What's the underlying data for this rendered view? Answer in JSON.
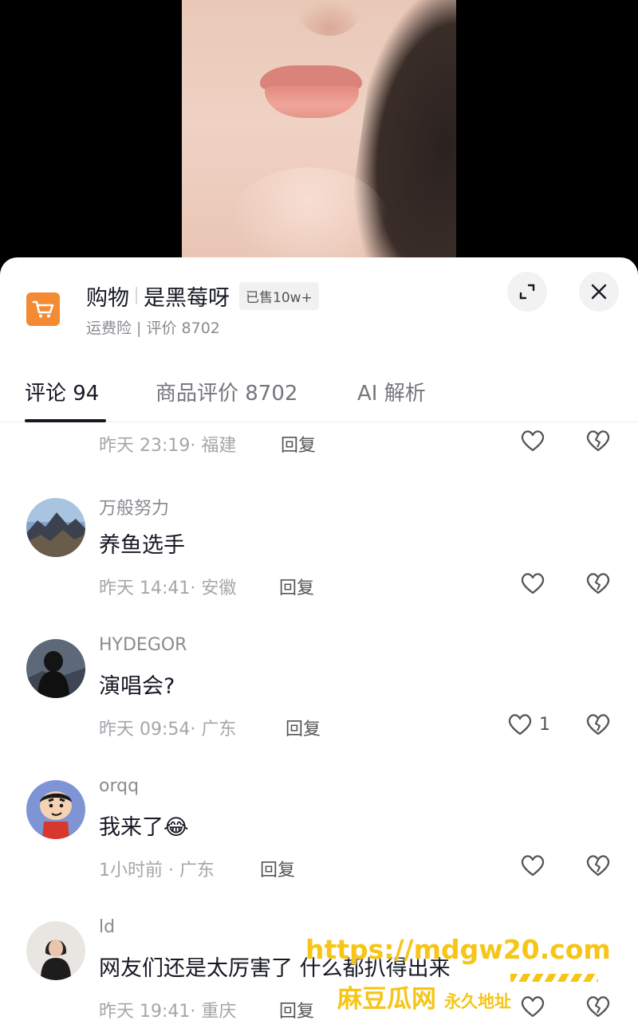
{
  "product": {
    "title": "购物",
    "shop": "是黑莓呀",
    "sold": "已售10w+",
    "meta": "运费险 | 评价 8702"
  },
  "tabs": [
    {
      "label": "评论 94",
      "active": true
    },
    {
      "label": "商品评价 8702",
      "active": false
    },
    {
      "label": "AI 解析",
      "active": false
    }
  ],
  "first_row": {
    "meta": "昨天 23:19· 福建",
    "reply": "回复"
  },
  "comments": [
    {
      "user": "万般努力",
      "text": "养鱼选手",
      "meta": "昨天 14:41· 安徽",
      "reply": "回复",
      "likes": "",
      "avatar": "mountain-avatar"
    },
    {
      "user": "HYDEGOR",
      "text": "演唱会?",
      "meta": "昨天 09:54· 广东",
      "reply": "回复",
      "likes": "1",
      "avatar": "dark-figure-avatar"
    },
    {
      "user": "orqq",
      "text": "我来了",
      "emoji": "😂",
      "meta": "1小时前 · 广东",
      "reply": "回复",
      "likes": "",
      "avatar": "cartoon-boy-avatar"
    },
    {
      "user": "ld",
      "text": "网友们还是太厉害了 什么都扒得出来",
      "meta": "昨天 19:41· 重庆",
      "reply": "回复",
      "likes": "",
      "avatar": "woman-avatar"
    }
  ],
  "watermark": {
    "url": "https://mdgw20.com",
    "site": "麻豆瓜网",
    "tagline": "永久地址"
  },
  "colors": {
    "cart_badge": "#f58a34",
    "watermark": "#f6c515",
    "text_primary": "#161823",
    "text_secondary": "#8a8b91"
  },
  "icons": [
    "shopping-cart-icon",
    "expand-icon",
    "close-icon",
    "heart-icon",
    "broken-heart-icon"
  ]
}
